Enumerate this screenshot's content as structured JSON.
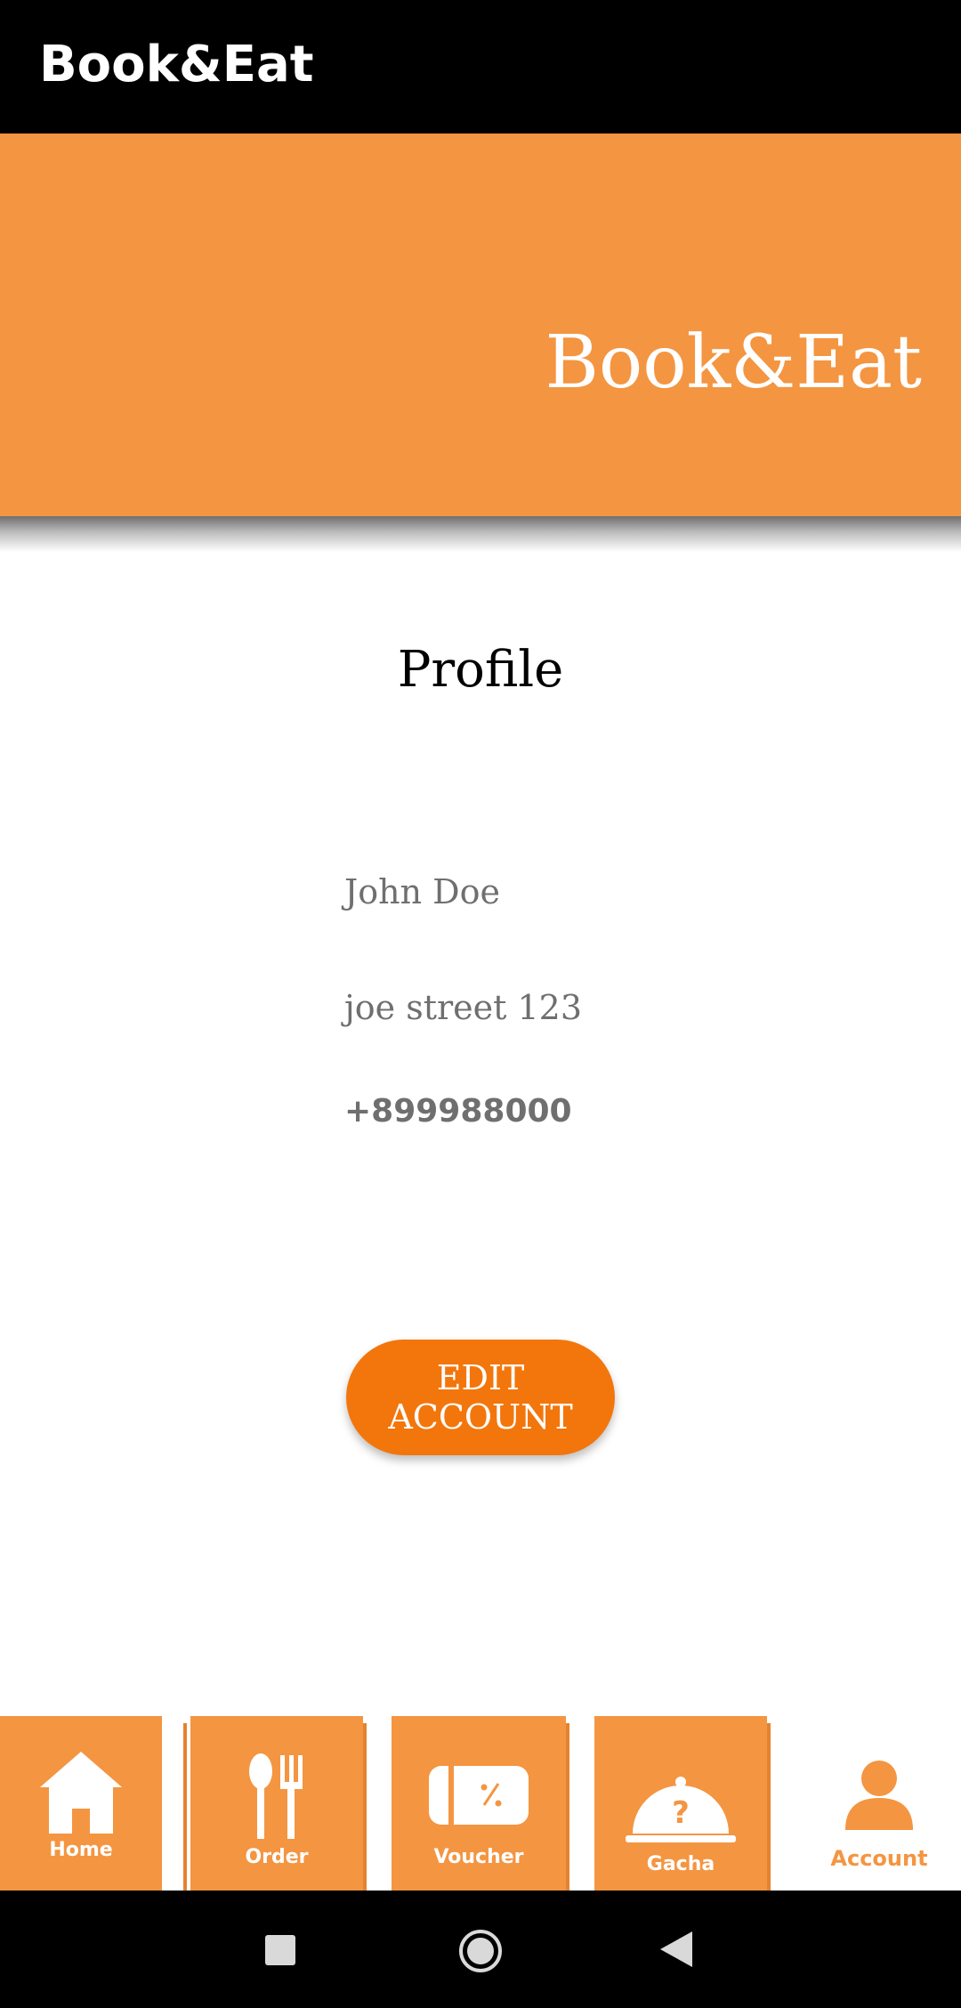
{
  "appbar": {
    "title": "Book&Eat"
  },
  "banner": {
    "title": "Book&Eat"
  },
  "profile": {
    "title": "Profile",
    "name": "John Doe",
    "address": "joe street 123",
    "phone": "+899988000",
    "edit_label": "EDIT ACCOUNT"
  },
  "nav": {
    "items": [
      {
        "label": "Home",
        "icon": "home-icon"
      },
      {
        "label": "Order",
        "icon": "spoon-fork-icon"
      },
      {
        "label": "Voucher",
        "icon": "voucher-icon"
      },
      {
        "label": "Gacha",
        "icon": "cloche-question-icon"
      },
      {
        "label": "Account",
        "icon": "person-icon",
        "active": true
      }
    ]
  },
  "system": {
    "buttons": [
      "recents-icon",
      "home-circle-icon",
      "back-icon"
    ]
  },
  "colors": {
    "accent": "#f49541",
    "button": "#f3760c",
    "text_gray": "#6f6f6f"
  }
}
